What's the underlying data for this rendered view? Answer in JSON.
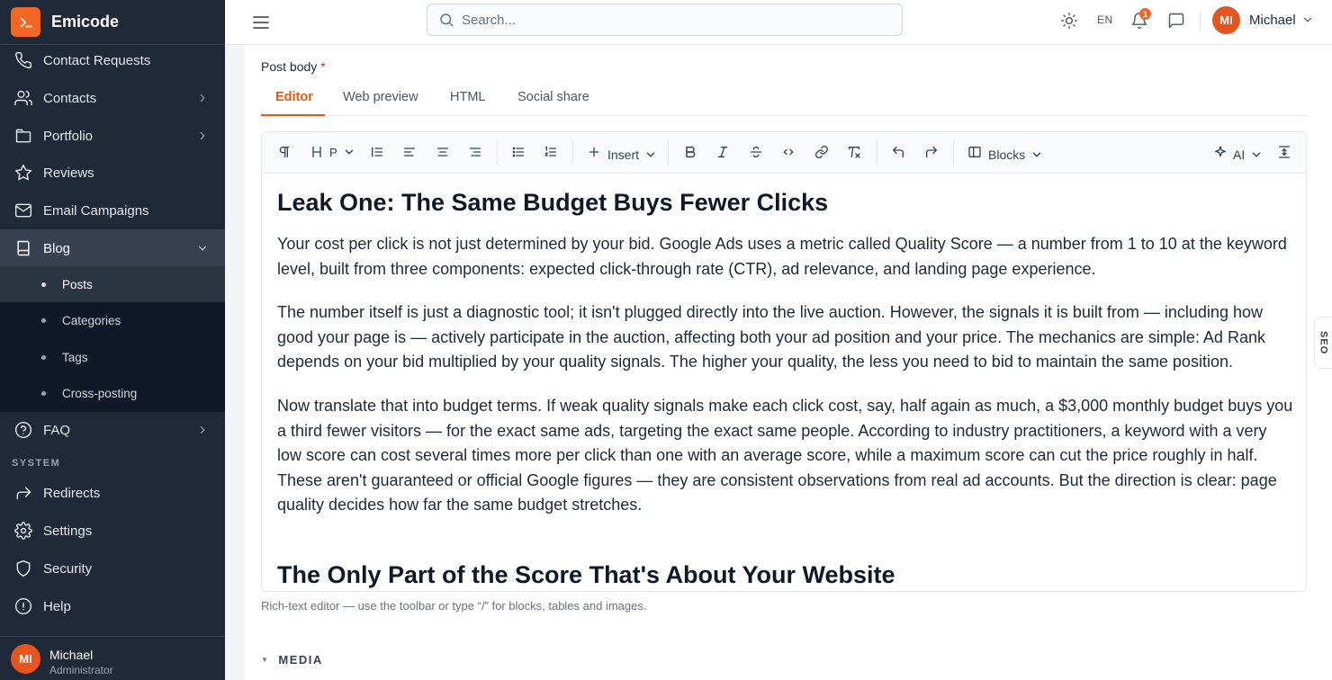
{
  "sidebar": {
    "brand": "Emicode",
    "items": [
      {
        "label": "Contact Requests",
        "icon": "phone-icon"
      },
      {
        "label": "Contacts",
        "icon": "users-icon"
      },
      {
        "label": "Portfolio",
        "icon": "briefcase-icon"
      },
      {
        "label": "Reviews",
        "icon": "star-icon"
      },
      {
        "label": "Email Campaigns",
        "icon": "mail-icon"
      },
      {
        "label": "Blog",
        "icon": "book-icon"
      },
      {
        "label": "FAQ",
        "icon": "help-circle-icon"
      }
    ],
    "blog_sub": [
      "Posts",
      "Categories",
      "Tags",
      "Cross-posting"
    ],
    "system_label": "SYSTEM",
    "system_items": [
      {
        "label": "Redirects",
        "icon": "redirect-icon"
      },
      {
        "label": "Settings",
        "icon": "gear-icon"
      },
      {
        "label": "Security",
        "icon": "shield-icon"
      },
      {
        "label": "Help",
        "icon": "info-icon"
      }
    ],
    "user": {
      "initials": "MI",
      "name": "Michael",
      "role": "Administrator"
    }
  },
  "topbar": {
    "search_placeholder": "Search...",
    "lang": "EN",
    "notif_count": "1",
    "user_initials": "MI",
    "user_name": "Michael"
  },
  "editor": {
    "field_label": "Post body",
    "required_mark": "*",
    "tabs": [
      "Editor",
      "Web preview",
      "HTML",
      "Social share"
    ],
    "toolbar": {
      "heading_value": "P",
      "insert": "Insert",
      "blocks": "Blocks",
      "ai": "AI"
    },
    "content": {
      "h1": "Leak One: The Same Budget Buys Fewer Clicks",
      "p1": "Your cost per click is not just determined by your bid. Google Ads uses a metric called Quality Score — a number from 1 to 10 at the keyword level, built from three components: expected click-through rate (CTR), ad relevance, and landing page experience.",
      "p2": "The number itself is just a diagnostic tool; it isn't plugged directly into the live auction. However, the signals it is built from — including how good your page is — actively participate in the auction, affecting both your ad position and your price. The mechanics are simple: Ad Rank depends on your bid multiplied by your quality signals. The higher your quality, the less you need to bid to maintain the same position.",
      "p3": "Now translate that into budget terms. If weak quality signals make each click cost, say, half again as much, a $3,000 monthly budget buys you a third fewer visitors — for the exact same ads, targeting the exact same people. According to industry practitioners, a keyword with a very low score can cost several times more per click than one with an average score, while a maximum score can cut the price roughly in half. These aren't guaranteed or official Google figures — they are consistent observations from real ad accounts. But the direction is clear: page quality decides how far the same budget stretches.",
      "h2": "The Only Part of the Score That's About Your Website"
    },
    "hint": "Rich-text editor — use the toolbar or type “/” for blocks, tables and images.",
    "media_label": "MEDIA",
    "seo_tab": "SEO"
  },
  "colors": {
    "accent": "#ea580c",
    "sidebar_bg": "#1f2937",
    "avatar": "#e8541e"
  }
}
